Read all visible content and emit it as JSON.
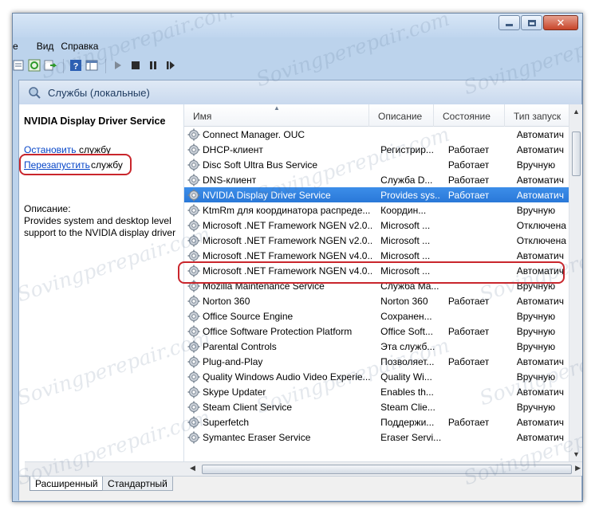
{
  "window": {
    "controls": {
      "minimize": "minimize",
      "maximize": "maximize",
      "close": "✕"
    }
  },
  "menu": {
    "items": [
      "е",
      "Вид",
      "Справка"
    ]
  },
  "toolbar": {
    "icons": [
      "list-icon",
      "refresh-icon",
      "export-icon",
      "help-icon",
      "properties-icon",
      "play-icon",
      "stop-icon",
      "pause-icon",
      "resume-icon"
    ]
  },
  "header": {
    "title": "Службы (локальные)"
  },
  "left_pane": {
    "service_title": "NVIDIA Display Driver Service",
    "stop_link": "Остановить",
    "stop_rest": "службу",
    "restart_link": "Перезапустить",
    "restart_rest": "службу",
    "desc_label": "Описание:",
    "description": "Provides system and desktop level support to the NVIDIA display driver"
  },
  "columns": {
    "name": "Имя",
    "desc": "Описание",
    "state": "Состояние",
    "start": "Тип запуск"
  },
  "rows": [
    {
      "name": "Connect Manager. OUC",
      "desc": "",
      "state": "",
      "start": "Автоматич"
    },
    {
      "name": "DHCP-клиент",
      "desc": "Регистрир...",
      "state": "Работает",
      "start": "Автоматич"
    },
    {
      "name": "Disc Soft Ultra Bus Service",
      "desc": "",
      "state": "Работает",
      "start": "Вручную"
    },
    {
      "name": "DNS-клиент",
      "desc": "Служба D...",
      "state": "Работает",
      "start": "Автоматич"
    },
    {
      "name": "NVIDIA Display Driver Service",
      "desc": "Provides sys...",
      "state": "Работает",
      "start": "Автоматич"
    },
    {
      "name": "KtmRm для координатора распреде...",
      "desc": "Координ...",
      "state": "",
      "start": "Вручную"
    },
    {
      "name": "Microsoft .NET Framework NGEN v2.0...",
      "desc": "Microsoft ...",
      "state": "",
      "start": "Отключена"
    },
    {
      "name": "Microsoft .NET Framework NGEN v2.0...",
      "desc": "Microsoft ...",
      "state": "",
      "start": "Отключена"
    },
    {
      "name": "Microsoft .NET Framework NGEN v4.0...",
      "desc": "Microsoft ...",
      "state": "",
      "start": "Автоматич"
    },
    {
      "name": "Microsoft .NET Framework NGEN v4.0...",
      "desc": "Microsoft ...",
      "state": "",
      "start": "Автоматич"
    },
    {
      "name": "Mozilla Maintenance Service",
      "desc": "Служба Ma...",
      "state": "",
      "start": "Вручную"
    },
    {
      "name": "Norton 360",
      "desc": "Norton 360",
      "state": "Работает",
      "start": "Автоматич"
    },
    {
      "name": "Office  Source Engine",
      "desc": "Сохранен...",
      "state": "",
      "start": "Вручную"
    },
    {
      "name": "Office Software Protection Platform",
      "desc": "Office Soft...",
      "state": "Работает",
      "start": "Вручную"
    },
    {
      "name": "Parental Controls",
      "desc": "Эта служб...",
      "state": "",
      "start": "Вручную"
    },
    {
      "name": "Plug-and-Play",
      "desc": "Позволяет...",
      "state": "Работает",
      "start": "Автоматич"
    },
    {
      "name": "Quality Windows Audio Video Experie...",
      "desc": "Quality Wi...",
      "state": "",
      "start": "Вручную"
    },
    {
      "name": "Skype Updater",
      "desc": "Enables th...",
      "state": "",
      "start": "Автоматич"
    },
    {
      "name": "Steam Client Service",
      "desc": "Steam Clie...",
      "state": "",
      "start": "Вручную"
    },
    {
      "name": "Superfetch",
      "desc": "Поддержи...",
      "state": "Работает",
      "start": "Автоматич"
    },
    {
      "name": "Symantec Eraser Service",
      "desc": "Eraser Servi...",
      "state": "",
      "start": "Автоматич"
    }
  ],
  "selected_row": 4,
  "tabs": {
    "extended": "Расширенный",
    "standard": "Стандартный"
  },
  "watermark": "Sovingperepair.com",
  "colors": {
    "selection": "#3385e4",
    "highlight_box": "#c9262c",
    "link": "#0645c8"
  }
}
